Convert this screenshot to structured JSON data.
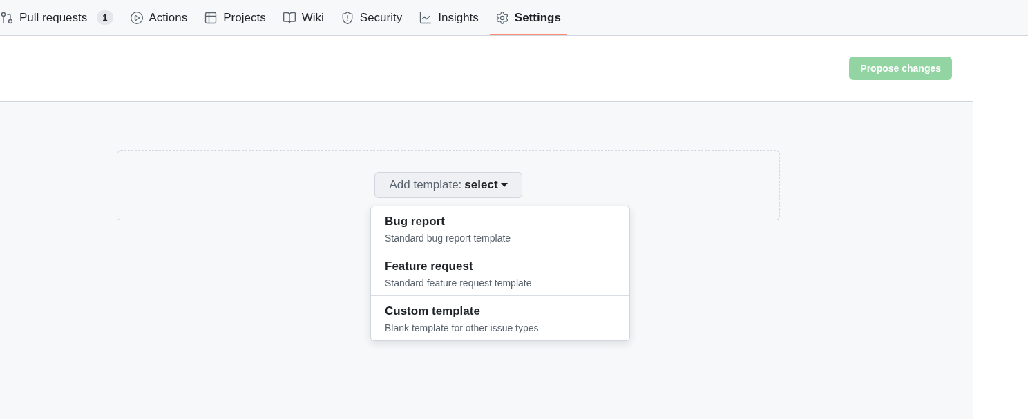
{
  "nav": {
    "tabs": [
      {
        "kind": "pulls",
        "label": "Pull requests",
        "counter": "1",
        "selected": false
      },
      {
        "kind": "actions",
        "label": "Actions",
        "selected": false
      },
      {
        "kind": "projects",
        "label": "Projects",
        "selected": false
      },
      {
        "kind": "wiki",
        "label": "Wiki",
        "selected": false
      },
      {
        "kind": "security",
        "label": "Security",
        "selected": false
      },
      {
        "kind": "insights",
        "label": "Insights",
        "selected": false
      },
      {
        "kind": "settings",
        "label": "Settings",
        "selected": true
      }
    ]
  },
  "header": {
    "propose_button": {
      "label": "Propose changes",
      "disabled": true
    }
  },
  "template_picker": {
    "button": {
      "label": "Add template: ",
      "value": "select"
    },
    "menu": {
      "open": true,
      "items": [
        {
          "title": "Bug report",
          "description": "Standard bug report template"
        },
        {
          "title": "Feature request",
          "description": "Standard feature request template"
        },
        {
          "title": "Custom template",
          "description": "Blank template for other issue types"
        }
      ]
    }
  }
}
